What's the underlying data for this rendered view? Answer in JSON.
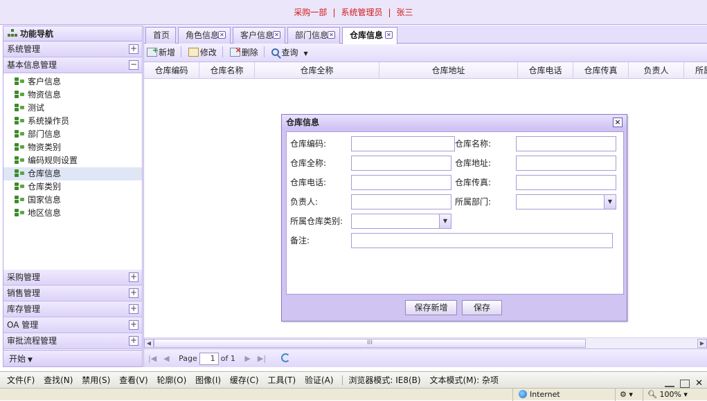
{
  "header": {
    "dept": "采购一部",
    "role": "系统管理员",
    "user": "张三",
    "sep": "|"
  },
  "nav": {
    "title": "功能导航",
    "top_groups": [
      {
        "label": "系统管理",
        "toggle": "+"
      },
      {
        "label": "基本信息管理",
        "toggle": "−"
      }
    ],
    "tree_items": [
      "客户信息",
      "物资信息",
      "测试",
      "系统操作员",
      "部门信息",
      "物资类别",
      "编码规则设置",
      "仓库信息",
      "仓库类别",
      "国家信息",
      "地区信息"
    ],
    "selected_item": "仓库信息",
    "bottom_groups": [
      {
        "label": "采购管理",
        "toggle": "+"
      },
      {
        "label": "销售管理",
        "toggle": "+"
      },
      {
        "label": "库存管理",
        "toggle": "+"
      },
      {
        "label": "OA 管理",
        "toggle": "+"
      },
      {
        "label": "审批流程管理",
        "toggle": "+"
      }
    ],
    "start": "开始"
  },
  "tabs": [
    {
      "label": "首页",
      "closable": false
    },
    {
      "label": "角色信息",
      "closable": true
    },
    {
      "label": "客户信息",
      "closable": true
    },
    {
      "label": "部门信息",
      "closable": true
    },
    {
      "label": "仓库信息",
      "closable": true,
      "active": true
    }
  ],
  "toolbar": {
    "add": "新增",
    "edit": "修改",
    "delete": "删除",
    "query": "查询"
  },
  "grid": {
    "columns": [
      "仓库编码",
      "仓库名称",
      "仓库全称",
      "仓库地址",
      "仓库电话",
      "仓库传真",
      "负责人",
      "所属"
    ]
  },
  "pager": {
    "page_label": "Page",
    "page_value": "1",
    "of_label": "of 1",
    "scroll_grip": "III"
  },
  "dialog": {
    "title": "仓库信息",
    "close": "×",
    "fields": {
      "code": "仓库编码:",
      "name": "仓库名称:",
      "fullname": "仓库全称:",
      "address": "仓库地址:",
      "phone": "仓库电话:",
      "fax": "仓库传真:",
      "manager": "负责人:",
      "dept": "所属部门:",
      "category": "所属仓库类别:",
      "remark": "备注:"
    },
    "buttons": {
      "save_new": "保存新增",
      "save": "保存"
    }
  },
  "ie_menu": [
    "文件(F)",
    "查找(N)",
    "禁用(S)",
    "查看(V)",
    "轮廓(O)",
    "图像(I)",
    "缓存(C)",
    "工具(T)",
    "验证(A)",
    "浏览器模式: IE8(B)",
    "文本模式(M): 杂项"
  ],
  "ie_status": {
    "zone": "Internet",
    "zoom": "100%"
  }
}
